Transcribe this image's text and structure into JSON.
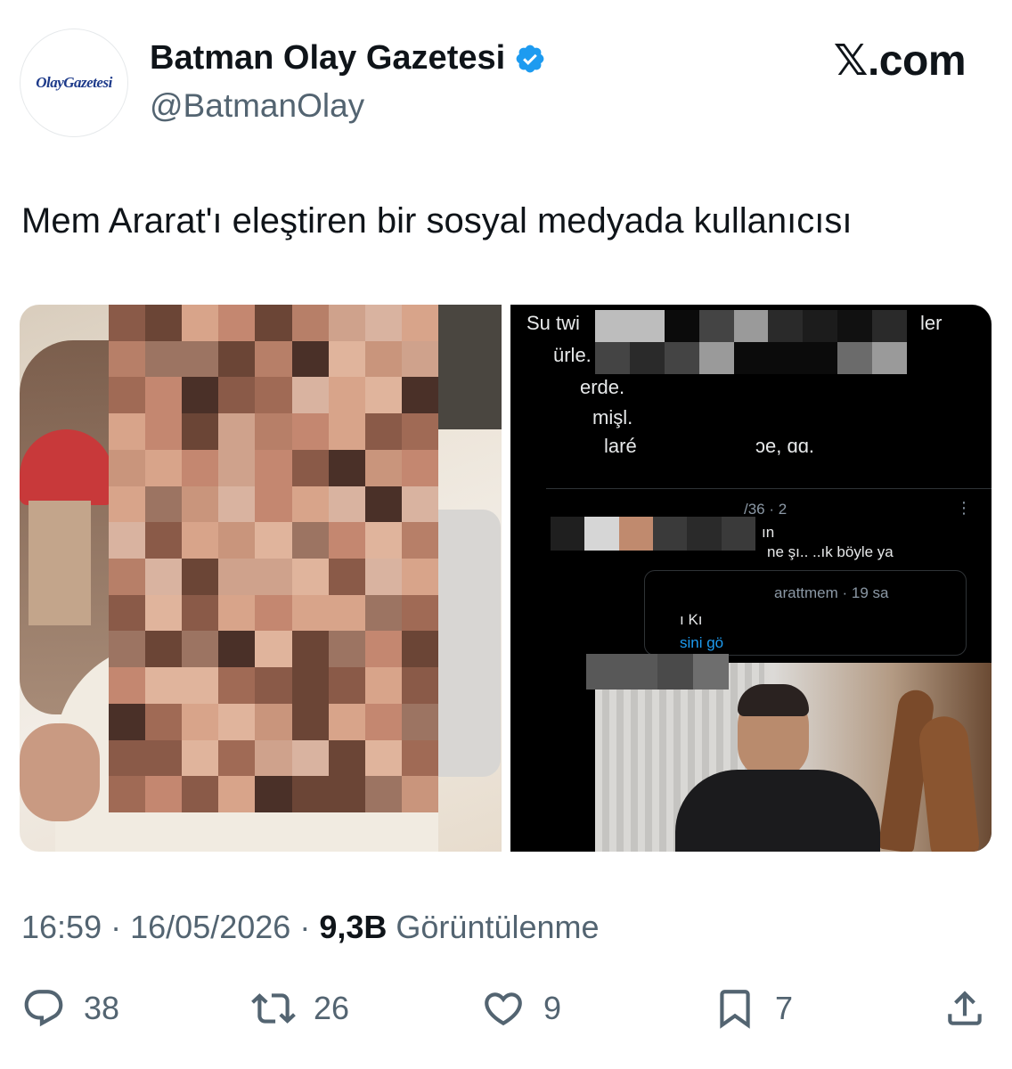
{
  "header": {
    "avatar_text": "OlayGazetesi",
    "display_name": "Batman Olay Gazetesi",
    "handle": "@BatmanOlay",
    "brand": "𝕏.com",
    "verified_color": "#1d9bf0"
  },
  "tweet": {
    "text": "Mem Ararat'ı eleştiren bir sosyal medyada kullanıcısı"
  },
  "media": {
    "right_screenshot": {
      "line1": "Su twi",
      "line1_end": "ler",
      "line2": "ürle.",
      "line3": "erde.",
      "line4": "mişl.",
      "line5": "laré",
      "line5_end": "ɔe, ɑɑ.",
      "reply_meta": "/36 · 2",
      "reply_line1": "ın",
      "reply_line2": "ne şı..  ..ık böyle ya",
      "quoted_meta": "arattmem · 19 sa",
      "quoted_line": "ı Kı",
      "quoted_link": "sini gö"
    }
  },
  "meta": {
    "time": "16:59",
    "separator": "·",
    "date": "16/05/2026",
    "views_count": "9,3B",
    "views_label": "Görüntülenme"
  },
  "actions": {
    "reply_count": "38",
    "repost_count": "26",
    "like_count": "9",
    "bookmark_count": "7"
  }
}
